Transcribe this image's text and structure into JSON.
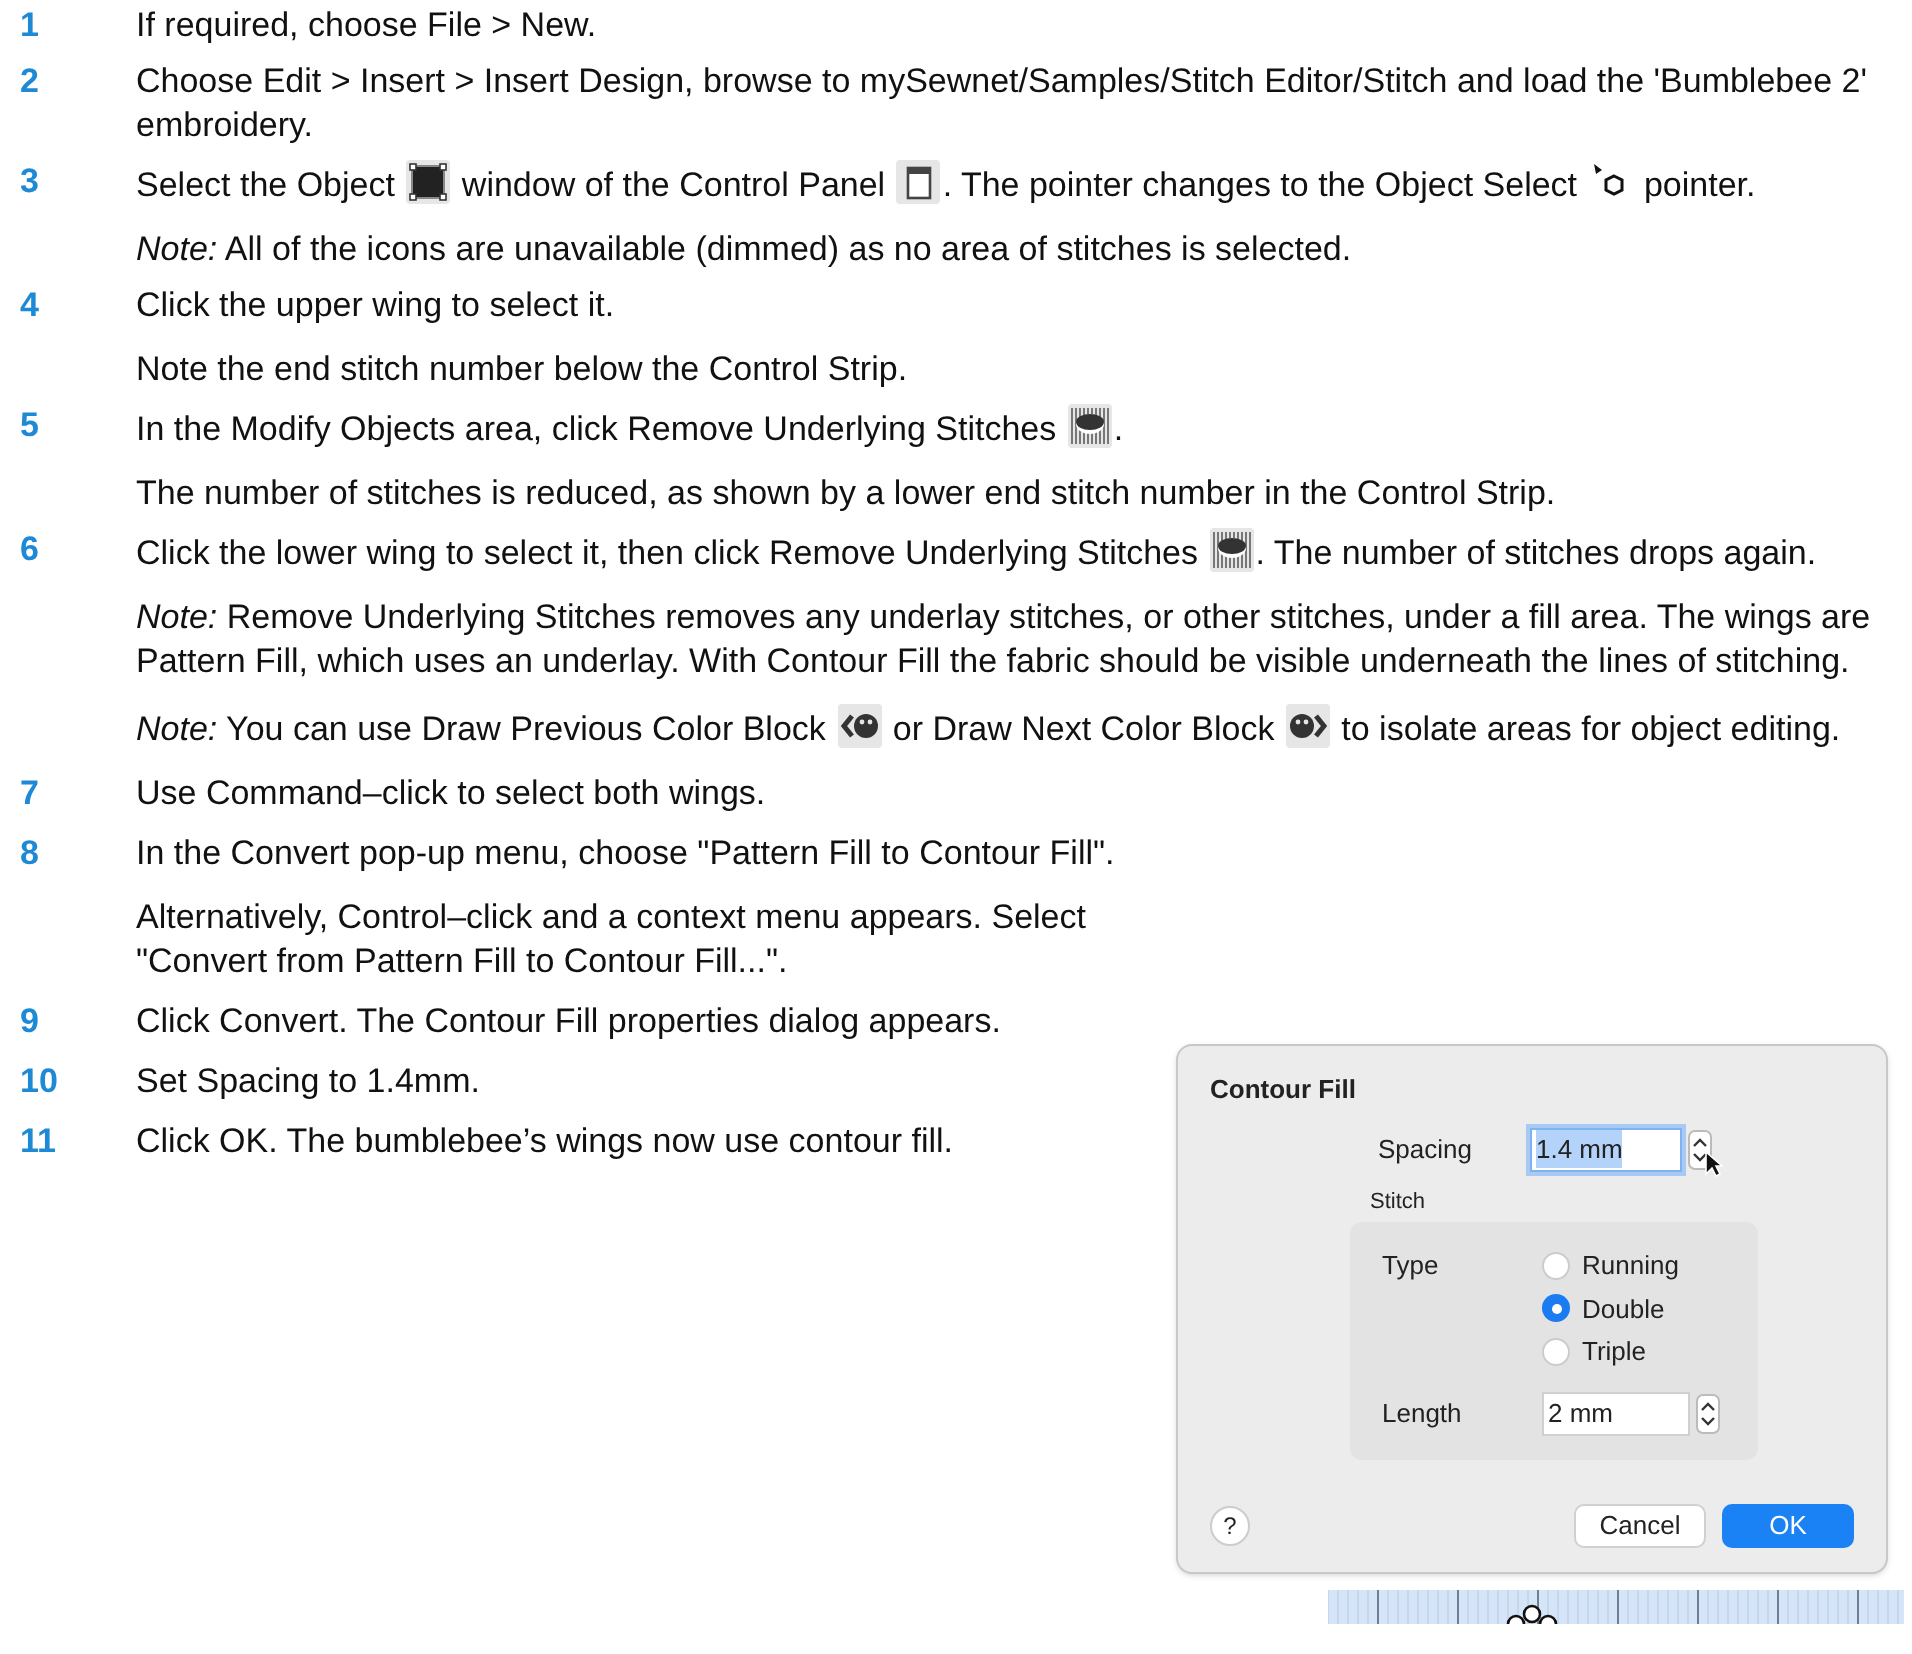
{
  "steps": [
    {
      "number": "1",
      "paragraphs": [
        {
          "parts": [
            {
              "kind": "text",
              "text": "If required, choose File > New."
            }
          ]
        }
      ]
    },
    {
      "number": "2",
      "paragraphs": [
        {
          "parts": [
            {
              "kind": "text",
              "text": "Choose Edit > Insert > Insert Design, browse to mySewnet/Samples/Stitch Editor/Stitch and load the 'Bumblebee 2' embroidery."
            }
          ]
        }
      ]
    },
    {
      "number": "3",
      "paragraphs": [
        {
          "parts": [
            {
              "kind": "text",
              "text": "Select the Object "
            },
            {
              "kind": "object"
            },
            {
              "kind": "text",
              "text": " window of the Control Panel "
            },
            {
              "kind": "panel"
            },
            {
              "kind": "text",
              "text": ". The pointer changes to the Object Select "
            },
            {
              "kind": "pointer"
            },
            {
              "kind": "text",
              "text": " pointer."
            }
          ]
        },
        {
          "parts": [
            {
              "kind": "text",
              "text": "*Note:* All of the icons are unavailable (dimmed) as no area of stitches is selected."
            }
          ]
        }
      ]
    },
    {
      "number": "4",
      "paragraphs": [
        {
          "parts": [
            {
              "kind": "text",
              "text": "Click the upper wing to select it."
            }
          ]
        },
        {
          "parts": [
            {
              "kind": "text",
              "text": "Note the end stitch number below the Control Strip."
            }
          ]
        }
      ]
    },
    {
      "number": "5",
      "paragraphs": [
        {
          "parts": [
            {
              "kind": "text",
              "text": "In the Modify Objects area, click Remove Underlying Stitches "
            },
            {
              "kind": "remove"
            },
            {
              "kind": "text",
              "text": "."
            }
          ]
        },
        {
          "parts": [
            {
              "kind": "text",
              "text": "The number of stitches is reduced, as shown by a lower end stitch number in the Control Strip."
            }
          ]
        }
      ]
    },
    {
      "number": "6",
      "paragraphs": [
        {
          "parts": [
            {
              "kind": "text",
              "text": "Click the lower wing to select it, then click Remove Underlying Stitches "
            },
            {
              "kind": "remove"
            },
            {
              "kind": "text",
              "text": ". The number of stitches drops again."
            }
          ]
        },
        {
          "parts": [
            {
              "kind": "text",
              "text": "*Note:* Remove Underlying Stitches removes any underlay stitches, or other stitches, under a fill area. The wings are Pattern Fill, which uses an underlay. With Contour Fill the fabric should be visible underneath the lines of stitching."
            }
          ]
        },
        {
          "parts": [
            {
              "kind": "text",
              "text": "*Note:* You can use Draw Previous Color Block "
            },
            {
              "kind": "previous"
            },
            {
              "kind": "text",
              "text": " or Draw Next Color Block "
            },
            {
              "kind": "next"
            },
            {
              "kind": "text",
              "text": " to isolate areas for object editing."
            }
          ]
        }
      ]
    }
  ],
  "steps_narrow": [
    {
      "number": "7",
      "paragraphs": [
        {
          "parts": [
            {
              "kind": "text",
              "text": "Use Command–click to select both wings."
            }
          ]
        }
      ]
    },
    {
      "number": "8",
      "paragraphs": [
        {
          "parts": [
            {
              "kind": "text",
              "text": "In the Convert pop-up menu, choose \"Pattern Fill to Contour Fill\"."
            }
          ]
        },
        {
          "parts": [
            {
              "kind": "text",
              "text": "Alternatively, Control–click and a context menu appears. Select \"Convert from Pattern Fill to Contour Fill...\"."
            }
          ]
        }
      ]
    },
    {
      "number": "9",
      "paragraphs": [
        {
          "parts": [
            {
              "kind": "text",
              "text": "Click Convert. The Contour Fill properties dialog appears."
            }
          ]
        }
      ]
    },
    {
      "number": "10",
      "paragraphs": [
        {
          "parts": [
            {
              "kind": "text",
              "text": "Set Spacing to 1.4mm."
            }
          ]
        }
      ]
    },
    {
      "number": "11",
      "paragraphs": [
        {
          "parts": [
            {
              "kind": "text",
              "text": "Click OK. The bumblebee’s wings now use contour fill."
            }
          ]
        }
      ]
    }
  ],
  "dialog": {
    "title": "Contour Fill",
    "spacing": {
      "label": "Spacing",
      "value": "1.4 mm",
      "highlighted": true
    },
    "group_label": "Stitch",
    "type": {
      "label": "Type",
      "options": [
        {
          "label": "Running",
          "selected": false
        },
        {
          "label": "Double",
          "selected": true
        },
        {
          "label": "Triple",
          "selected": false
        }
      ]
    },
    "length": {
      "label": "Length",
      "value": "2 mm",
      "highlighted": false
    },
    "help": "?",
    "buttons": [
      {
        "label": "Cancel",
        "kind": "secondary"
      },
      {
        "label": "OK",
        "kind": "primary"
      }
    ]
  }
}
